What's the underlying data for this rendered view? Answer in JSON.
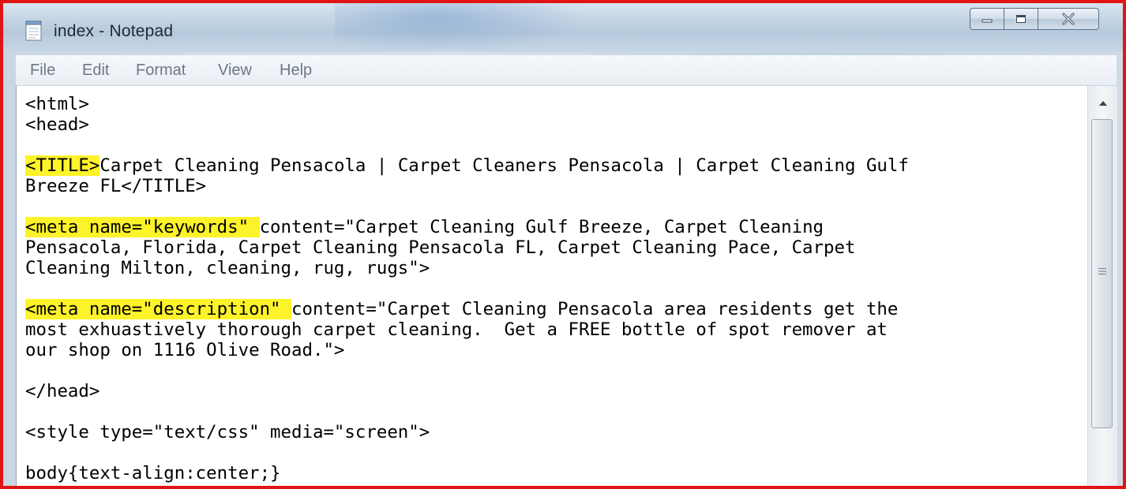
{
  "window": {
    "title": "index - Notepad"
  },
  "menu": {
    "items": [
      "File",
      "Edit",
      "Format",
      "View",
      "Help"
    ]
  },
  "editor": {
    "highlight_color": "#fdf32a",
    "lines": {
      "l1": "<html>",
      "l2": "<head>",
      "l4_hl": "<TITLE>",
      "l4_rest": "Carpet Cleaning Pensacola | Carpet Cleaners Pensacola | Carpet Cleaning Gulf",
      "l5": "Breeze FL</TITLE>",
      "l7_hl": "<meta name=\"keywords\" ",
      "l7_rest": "content=\"Carpet Cleaning Gulf Breeze, Carpet Cleaning",
      "l8": "Pensacola, Florida, Carpet Cleaning Pensacola FL, Carpet Cleaning Pace, Carpet",
      "l9": "Cleaning Milton, cleaning, rug, rugs\">",
      "l11_hl": "<meta name=\"description\" ",
      "l11_rest": "content=\"Carpet Cleaning Pensacola area residents get the",
      "l12": "most exhuastively thorough carpet cleaning.  Get a FREE bottle of spot remover at",
      "l13": "our shop on 1116 Olive Road.\">",
      "l15": "</head>",
      "l17": "<style type=\"text/css\" media=\"screen\">",
      "l19": "body{text-align:center;}"
    }
  },
  "frame_color": "#e01414"
}
